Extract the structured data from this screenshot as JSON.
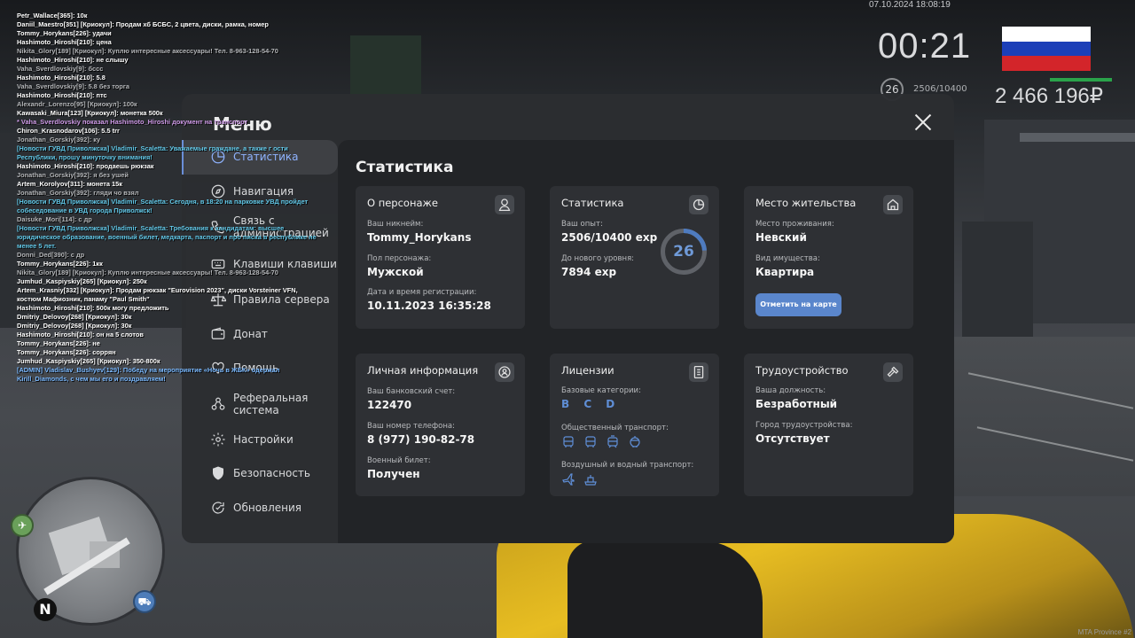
{
  "hud": {
    "datetime": "07.10.2024 18:08:19",
    "time": "00:21",
    "level": "26",
    "exp": "2506/10400",
    "money": "2 466 196₽",
    "flag_colors": [
      "#ffffff",
      "#1c3fb8",
      "#d3252a"
    ]
  },
  "watermark": "MTA Province #2",
  "map": {
    "north": "N"
  },
  "chat": [
    {
      "text": "Petr_Wallace[365]: 10к",
      "cls": ""
    },
    {
      "text": "Daniil_Maestro[351] [Криокул]: Продам хб БСБС, 2 цвета, диски, рамка, номер",
      "cls": ""
    },
    {
      "text": "Tommy_Horykans[226]: удачи",
      "cls": ""
    },
    {
      "text": "Hashimoto_Hiroshi[210]: цена",
      "cls": ""
    },
    {
      "text": "Nikita_Glory[189] [Криокул]: Куплю интересные аксессуары! Тел. 8-963-128-54-70",
      "cls": "gray"
    },
    {
      "text": "Hashimoto_Hiroshi[210]: не слышу",
      "cls": ""
    },
    {
      "text": "Vaha_Sverdlovskiy[9]: бссс",
      "cls": "gray"
    },
    {
      "text": "Hashimoto_Hiroshi[210]: 5.8",
      "cls": ""
    },
    {
      "text": "Vaha_Sverdlovskiy[9]: 5.8 без торга",
      "cls": "gray"
    },
    {
      "text": "Hashimoto_Hiroshi[210]: птс",
      "cls": ""
    },
    {
      "text": "Alexandr_Lorenzo[95] [Криокул]: 100к",
      "cls": "gray"
    },
    {
      "text": "Kawasaki_Miura[123] [Криокул]: монетка 500к",
      "cls": ""
    },
    {
      "text": " * Vaha_Sverdlovskiy показал Hashimoto_Hiroshi документ на транспорт",
      "cls": "pink"
    },
    {
      "text": "Chiron_Krasnodarov[106]: 5.5 trr",
      "cls": ""
    },
    {
      "text": "Jonathan_Gorskiy[392]: ку",
      "cls": "gray"
    },
    {
      "text": "[Новости ГУВД Приволжска] Vladimir_Scaletta: Уважаемые граждане, а также г ости Республики, прошу минуточку внимания!",
      "cls": "news wrap"
    },
    {
      "text": "Hashimoto_Hiroshi[210]: продаешь рюкзак",
      "cls": ""
    },
    {
      "text": "Jonathan_Gorskiy[392]: я без ушей",
      "cls": "gray"
    },
    {
      "text": "Artem_Korolyov[311]: монета 15к",
      "cls": ""
    },
    {
      "text": "Jonathan_Gorskiy[392]: гляди чо взял",
      "cls": "gray"
    },
    {
      "text": "[Новости ГУВД Приволжска] Vladimir_Scaletta: Сегодня, в 18:20 на парковке УВД пройдет собеседование в УВД города Приволжск!",
      "cls": "news wrap"
    },
    {
      "text": "Daisuke_Mori[114]: с др",
      "cls": "gray"
    },
    {
      "text": "[Новости ГУВД Приволжска] Vladimir_Scaletta: Требования к кандидатам: высшее юридическое образование, военный билет, медкарта, паспорт и про писка в республике не менее 5 лет.",
      "cls": "news wrap"
    },
    {
      "text": "Donni_Ded[390]: с др",
      "cls": "gray"
    },
    {
      "text": "Tommy_Horykans[226]: 1кк",
      "cls": ""
    },
    {
      "text": "Nikita_Glory[189] [Криокул]: Куплю интересные аксессуары! Тел. 8-963-128-54-70",
      "cls": "gray"
    },
    {
      "text": "Jumhud_Kaspiyskiy[265] [Криокул]: 250к",
      "cls": ""
    },
    {
      "text": "Artem_Krasniy[332] [Криокул]: Продам рюкзак \"Eurovision 2023\", диски Vorsteiner VFN, костюм Мафиозник, панаму \"Paul Smith\"",
      "cls": "wrap"
    },
    {
      "text": "Hashimoto_Hiroshi[210]: 500к могу предложить",
      "cls": ""
    },
    {
      "text": "Dmitriy_Delovoy[268] [Криокул]: 30к",
      "cls": ""
    },
    {
      "text": "Dmitriy_Delovoy[268] [Криокул]: 30к",
      "cls": ""
    },
    {
      "text": "Hashimoto_Hiroshi[210]: он на 5 слотов",
      "cls": ""
    },
    {
      "text": "Tommy_Horykans[226]: не",
      "cls": ""
    },
    {
      "text": "Tommy_Horykans[226]: соррян",
      "cls": ""
    },
    {
      "text": "Jumhud_Kaspiyskiy[265] [Криокул]: 350-800к",
      "cls": ""
    },
    {
      "text": "[ADMIN] Vladislav_Bushyev[129]: Победу на мероприятие «Ночь в ЖБК» одержал Kirill_Diamonds, с чем мы его и поздравляем!",
      "cls": "admin wrap"
    }
  ],
  "menu": {
    "title": "Меню",
    "content_title": "Статистика",
    "nav": [
      {
        "label": "Статистика",
        "icon": "chart-pie-icon",
        "name": "nav-statistics",
        "active": true
      },
      {
        "label": "Навигация",
        "icon": "compass-icon",
        "name": "nav-navigation"
      },
      {
        "label": "Связь с администрацией",
        "icon": "phone-icon",
        "name": "nav-admin-contact"
      },
      {
        "label": "Клавиши клавиши",
        "icon": "keyboard-icon",
        "name": "nav-keys"
      },
      {
        "label": "Правила сервера",
        "icon": "scales-icon",
        "name": "nav-server-rules"
      },
      {
        "label": "Донат",
        "icon": "wallet-icon",
        "name": "nav-donate"
      },
      {
        "label": "Помощь",
        "icon": "heart-hand-icon",
        "name": "nav-help"
      },
      {
        "label": "Реферальная система",
        "icon": "referral-icon",
        "name": "nav-referral"
      },
      {
        "label": "Настройки",
        "icon": "gear-icon",
        "name": "nav-settings"
      },
      {
        "label": "Безопасность",
        "icon": "shield-icon",
        "name": "nav-security"
      },
      {
        "label": "Обновления",
        "icon": "refresh-icon",
        "name": "nav-updates"
      }
    ],
    "cards": {
      "character": {
        "title": "О персонаже",
        "icon": "user-icon",
        "nick_label": "Ваш никнейм:",
        "nick": "Tommy_Horykans",
        "sex_label": "Пол персонажа:",
        "sex": "Мужской",
        "reg_label": "Дата и время регистрации:",
        "reg": "10.11.2023 16:35:28"
      },
      "stats": {
        "title": "Статистика",
        "icon": "chart-pie-icon",
        "exp_label": "Ваш опыт:",
        "exp": "2506/10400 exp",
        "next_label": "До нового уровня:",
        "next": "7894 exp",
        "level": "26",
        "progress": 0.24
      },
      "residence": {
        "title": "Место жительства",
        "icon": "home-icon",
        "place_label": "Место проживания:",
        "place": "Невский",
        "property_label": "Вид имущества:",
        "property": "Квартира",
        "button": "Отметить на карте"
      },
      "personal": {
        "title": "Личная информация",
        "icon": "user-circle-icon",
        "bank_label": "Ваш банковский счет:",
        "bank": "122470",
        "phone_label": "Ваш номер телефона:",
        "phone": "8 (977) 190-82-78",
        "military_label": "Военный билет:",
        "military": "Получен"
      },
      "licenses": {
        "title": "Лицензии",
        "icon": "license-icon",
        "base_label": "Базовые категории:",
        "base": "B C D",
        "public_label": "Общественный транспорт:",
        "public_icons": [
          "bus-icon",
          "bus-icon",
          "tram-icon",
          "trolleybus-icon"
        ],
        "air_label": "Воздушный и водный транспорт:",
        "air_icons": [
          "plane-icon",
          "boat-icon"
        ]
      },
      "employment": {
        "title": "Трудоустройство",
        "icon": "hammer-icon",
        "post_label": "Ваша должность:",
        "post": "Безработный",
        "city_label": "Город трудоустройства:",
        "city": "Отсутствует"
      }
    }
  }
}
